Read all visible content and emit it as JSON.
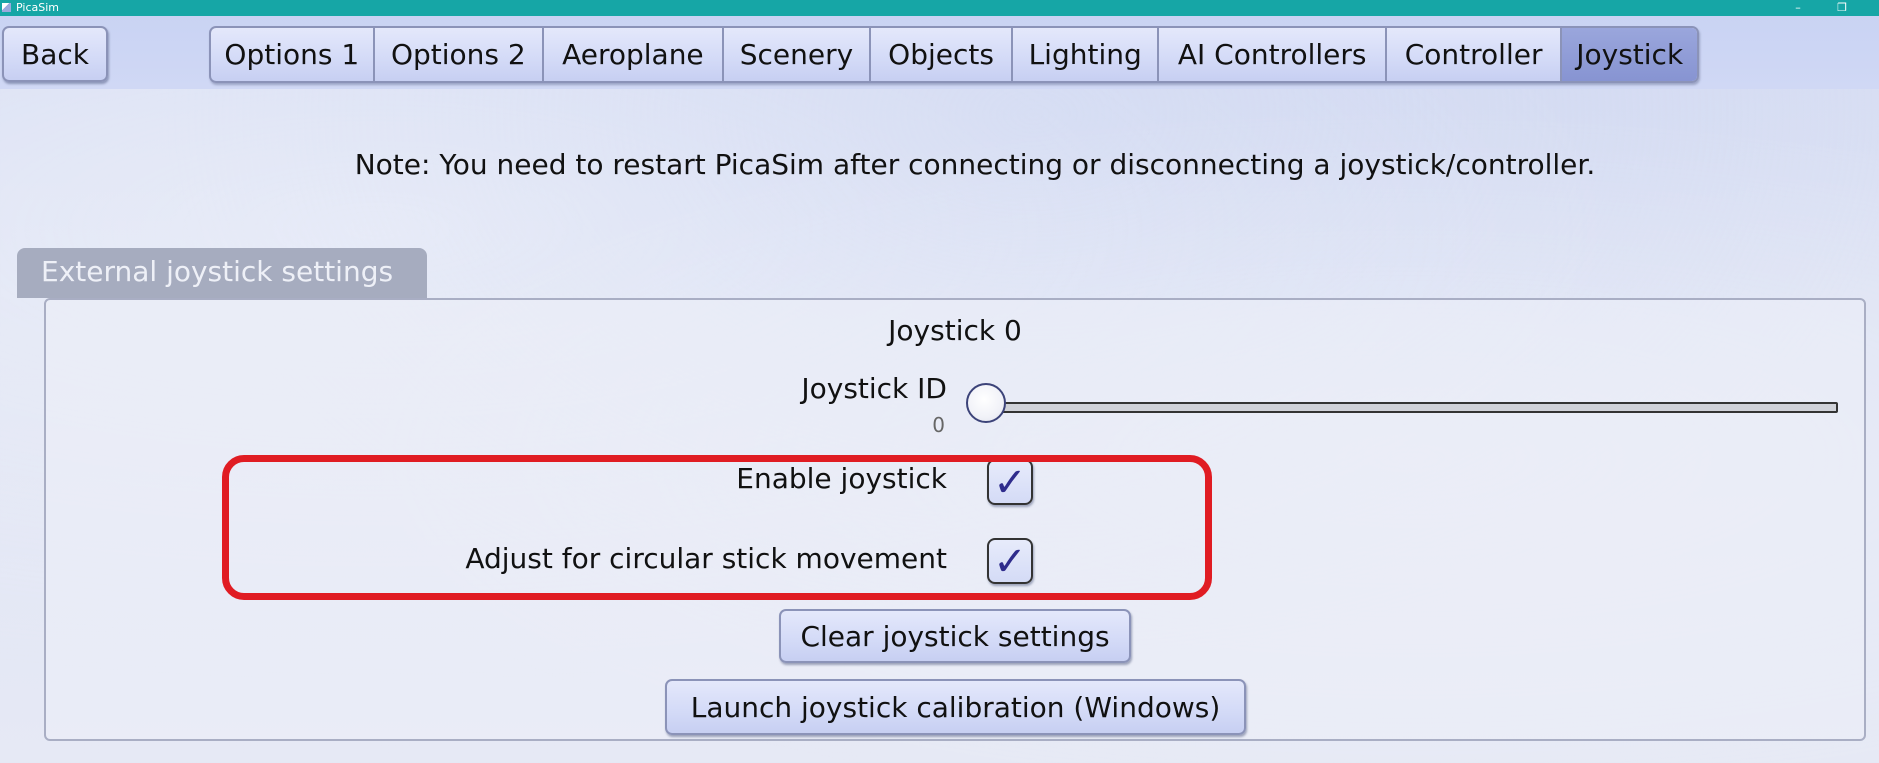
{
  "window": {
    "title": "PicaSim",
    "controls": {
      "minimize": "–",
      "restore": "❐"
    }
  },
  "back_button": {
    "label": "Back"
  },
  "tabs": [
    {
      "label": "Options 1",
      "active": false
    },
    {
      "label": "Options 2",
      "active": false
    },
    {
      "label": "Aeroplane",
      "active": false
    },
    {
      "label": "Scenery",
      "active": false
    },
    {
      "label": "Objects",
      "active": false
    },
    {
      "label": "Lighting",
      "active": false
    },
    {
      "label": "AI Controllers",
      "active": false
    },
    {
      "label": "Controller",
      "active": false
    },
    {
      "label": "Joystick",
      "active": true
    }
  ],
  "note": "Note: You need to restart PicaSim after connecting or disconnecting a joystick/controller.",
  "section": {
    "title": "External joystick settings",
    "joystick_heading": "Joystick 0",
    "joystick_id": {
      "label": "Joystick ID",
      "value": "0",
      "slider_fraction": 0
    },
    "enable_joystick": {
      "label": "Enable joystick",
      "checked": true
    },
    "circular_adjust": {
      "label": "Adjust for circular stick movement",
      "checked": true
    },
    "clear_button": "Clear joystick settings",
    "calibration_button": "Launch joystick calibration (Windows)"
  },
  "checkmark_glyph": "✓",
  "colors": {
    "accent_tab": "#8794d2",
    "highlight": "#e01c23",
    "titlebar": "#16a6a6"
  }
}
